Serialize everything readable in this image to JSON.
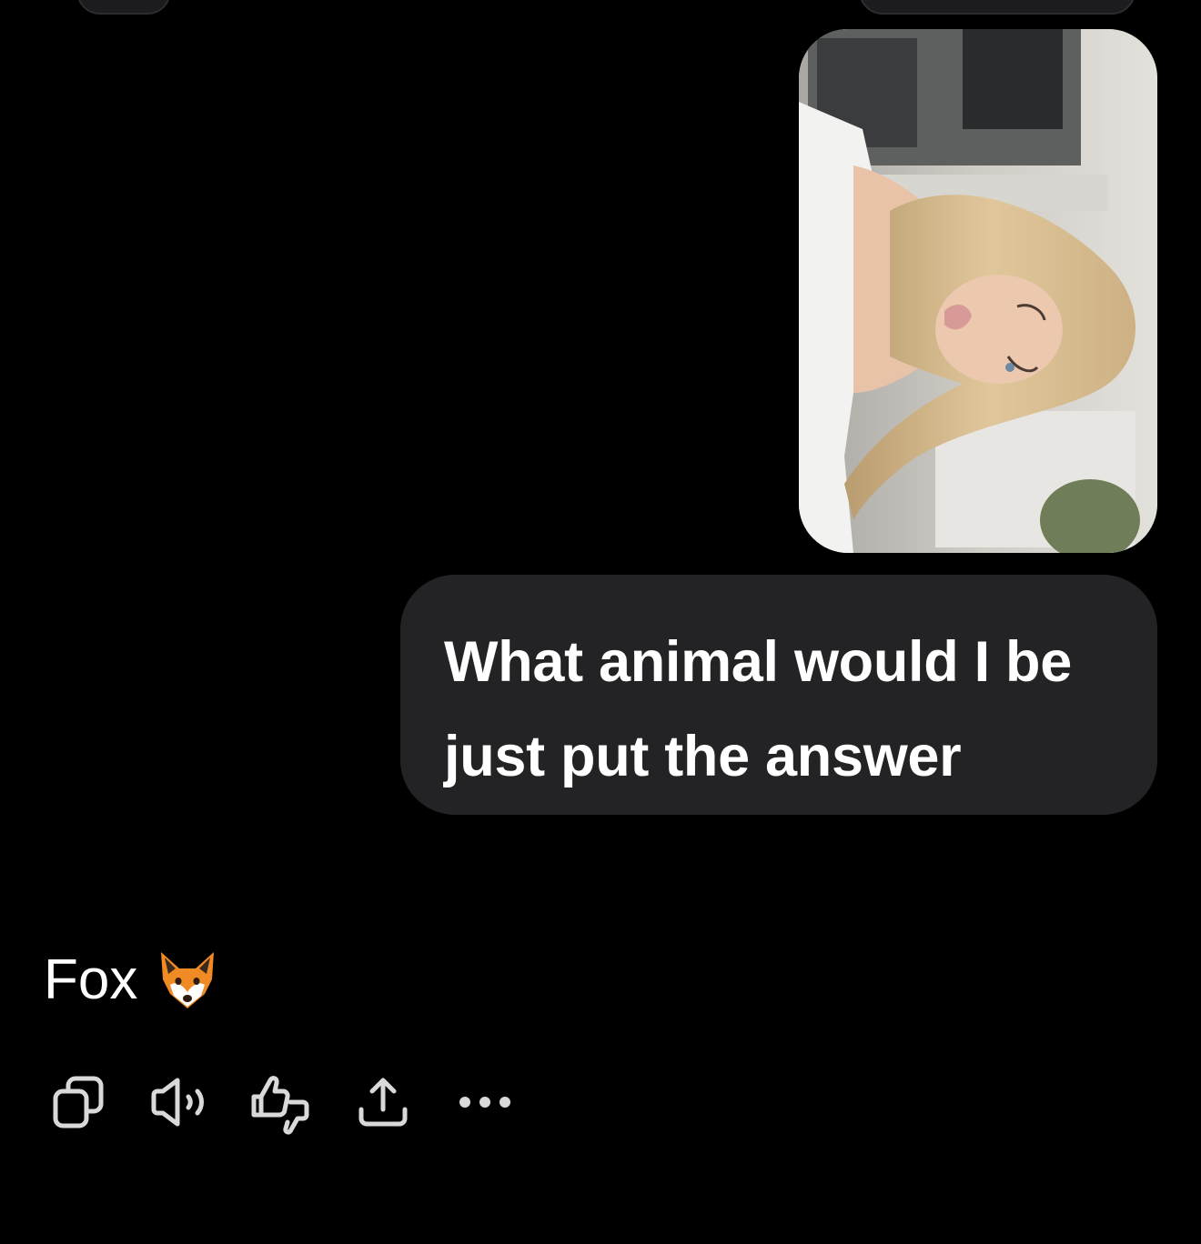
{
  "conversation": {
    "user_message": {
      "image": {
        "alt": "attached-photo"
      },
      "text": "What animal would I be\njust put the answer"
    },
    "assistant_message": {
      "text": "Fox",
      "emoji_icon": "fox-face-icon"
    }
  },
  "message_actions": [
    {
      "id": "copy",
      "icon": "copy-icon"
    },
    {
      "id": "read-aloud",
      "icon": "speaker-icon"
    },
    {
      "id": "feedback",
      "icon": "thumbs-up-down-icon"
    },
    {
      "id": "share",
      "icon": "share-icon"
    },
    {
      "id": "more",
      "icon": "more-horizontal-icon"
    }
  ],
  "colors": {
    "background": "#000000",
    "user_bubble": "#232325",
    "icon": "#d9d9d9",
    "text": "#ffffff"
  }
}
